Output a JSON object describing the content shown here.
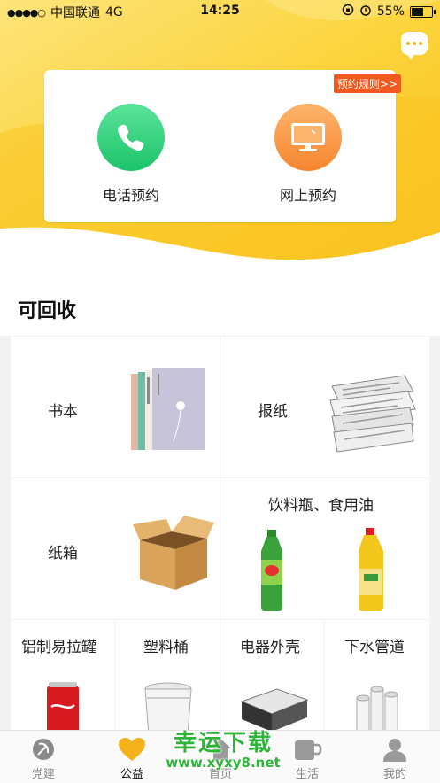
{
  "status_bar": {
    "carrier": "中国联通",
    "network": "4G",
    "time": "14:25",
    "battery": "55%",
    "battery_level": 0.55
  },
  "booking": {
    "rules_label": "预约规则>>",
    "phone_label": "电话预约",
    "online_label": "网上预约"
  },
  "recyclable": {
    "title": "可回收",
    "items": {
      "books": "书本",
      "newspaper": "报纸",
      "carton": "纸箱",
      "bottles_oil": "饮料瓶、食用油",
      "cans": "铝制易拉罐",
      "plastic_bucket": "塑料桶",
      "appliance_shell": "电器外壳",
      "drain_pipe": "下水管道"
    }
  },
  "bottom_nav": {
    "items": [
      {
        "label": "党建"
      },
      {
        "label": "公益"
      },
      {
        "label": "首页"
      },
      {
        "label": "生活"
      },
      {
        "label": "我的"
      }
    ],
    "active_index": 1
  },
  "watermark": {
    "line1": "幸运下载",
    "line2": "www.xyxy8.net"
  },
  "colors": {
    "header_yellow": "#fbd33a",
    "accent_orange": "#f05a21",
    "green_button": "#1cc46b",
    "orange_button": "#f7862f"
  }
}
